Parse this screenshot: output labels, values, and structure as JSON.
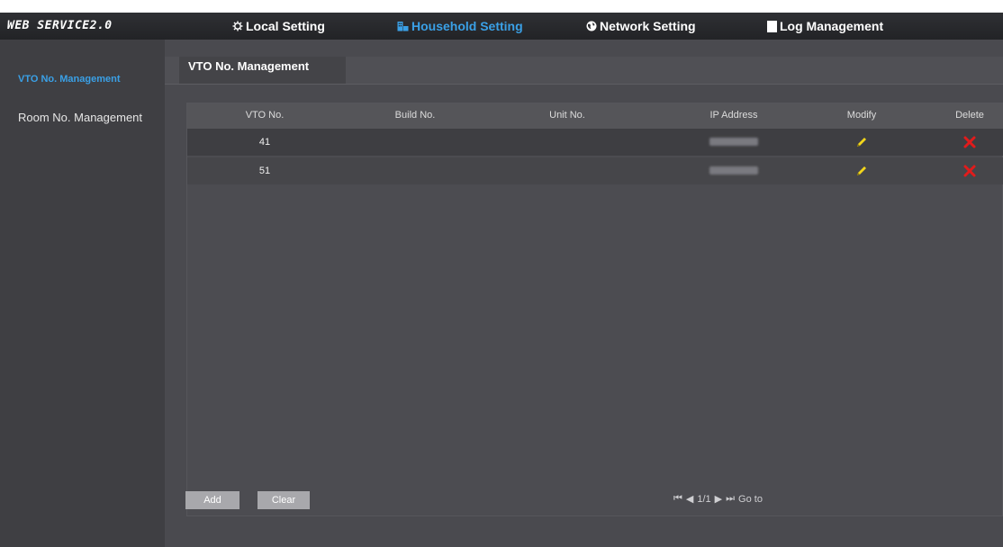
{
  "header": {
    "brand": "WEB SERVICE2.0",
    "nav": [
      {
        "label": "Local Setting",
        "icon": "gear-icon"
      },
      {
        "label": "Household Setting",
        "icon": "household-icon",
        "active": true
      },
      {
        "label": "Network Setting",
        "icon": "globe-icon"
      },
      {
        "label": "Log Management",
        "icon": "log-icon"
      }
    ]
  },
  "sidebar": {
    "items": [
      {
        "label": "VTO No. Management",
        "active": true
      },
      {
        "label": "Room No. Management",
        "active": false
      }
    ]
  },
  "tab": {
    "label": "VTO No. Management"
  },
  "table": {
    "columns": [
      "VTO No.",
      "Build No.",
      "Unit No.",
      "IP Address",
      "Modify",
      "Delete"
    ],
    "rows": [
      {
        "vto": "41",
        "build": "",
        "unit": "",
        "ip": "",
        "modify": "pencil-icon",
        "delete": "delete-x-icon"
      },
      {
        "vto": "51",
        "build": "",
        "unit": "",
        "ip": "",
        "modify": "pencil-icon",
        "delete": "delete-x-icon"
      }
    ]
  },
  "footer": {
    "add_label": "Add",
    "clear_label": "Clear",
    "page_indicator": "1/1",
    "goto_label": "Go to"
  },
  "colors": {
    "accent": "#3aa0e6",
    "modify_icon": "#f2d51b",
    "delete_icon": "#e21b1b"
  }
}
